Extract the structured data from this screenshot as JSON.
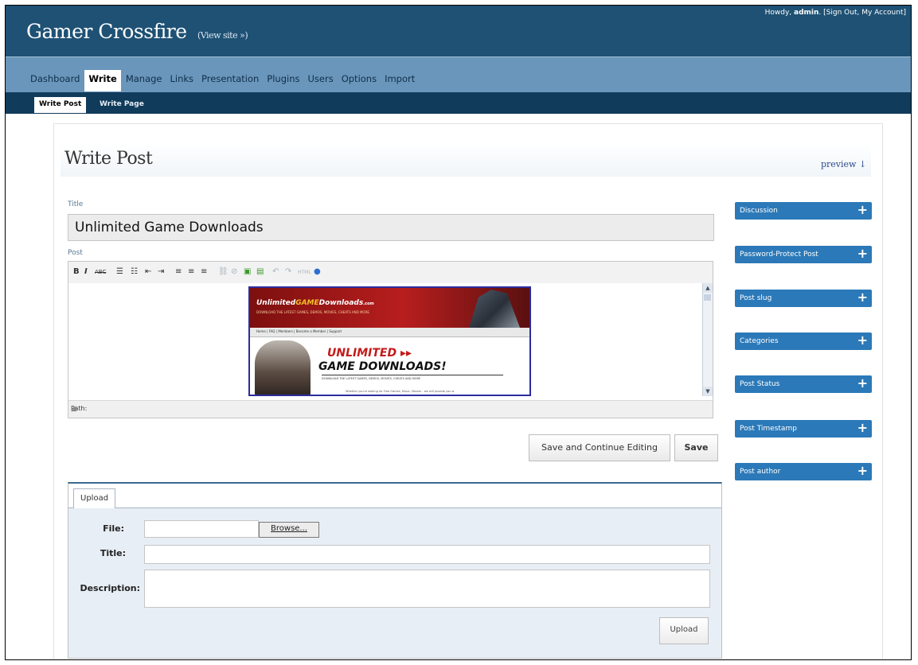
{
  "header": {
    "site_title": "Gamer Crossfire",
    "view_site": "(View site »)",
    "user_howdy": "Howdy,",
    "user_name": "admin",
    "user_links": "[Sign Out, My Account]"
  },
  "nav": {
    "tabs": [
      "Dashboard",
      "Write",
      "Manage",
      "Links",
      "Presentation",
      "Plugins",
      "Users",
      "Options",
      "Import"
    ],
    "active": "Write",
    "subtabs": [
      "Write Post",
      "Write Page"
    ]
  },
  "page": {
    "title": "Write Post",
    "preview": "preview ↓"
  },
  "form": {
    "title_label": "Title",
    "title_value": "Unlimited Game Downloads",
    "post_label": "Post",
    "path_label": "Path:"
  },
  "toolbar": {
    "bold": "B",
    "italic": "I",
    "strike": "ABC",
    "ul": "☰",
    "ol": "☷",
    "outdent": "⇤",
    "indent": "⇥",
    "align_left": "≡",
    "align_center": "≡",
    "align_right": "≡",
    "link": "⛓",
    "unlink": "⊘",
    "image": "▣",
    "more": "▤",
    "undo": "↶",
    "redo": "↷",
    "html": "HTML",
    "help": "●"
  },
  "embed": {
    "logo_prefix": "Unlimited",
    "logo_game": "GAME",
    "logo_suffix": "Downloads",
    "logo_tld": ".com",
    "tagline": "DOWNLOAD THE LATEST GAMES, DEMOS, MOVIES, CHEATS AND MORE",
    "menu": "Home  |  FAQ  |  Members  |  Become a Member  |  Support",
    "headline1": "UNLIMITED ▸▸",
    "headline2": "GAME DOWNLOADS!",
    "small1": "DOWNLOAD THE LATEST GAMES, DEMOS, MOVIES, CHEATS AND MORE",
    "small2": "Whether you're looking for Free Games, Music, Movies - we will provide you w"
  },
  "buttons": {
    "save_continue": "Save and Continue Editing",
    "save": "Save"
  },
  "upload": {
    "tab": "Upload",
    "file_label": "File:",
    "browse": "Browse...",
    "title_label": "Title:",
    "description_label": "Description:",
    "upload_button": "Upload"
  },
  "sidebar": {
    "boxes": [
      "Discussion",
      "Password-Protect Post",
      "Post slug",
      "Categories",
      "Post Status",
      "Post Timestamp",
      "Post author"
    ],
    "plus": "+"
  },
  "colors": {
    "header_bg": "#1e5174",
    "nav_bg": "#6a96bb",
    "subnav_bg": "#103b5a",
    "sidebar_box": "#2b79b8",
    "upload_bg": "#e8eef5"
  }
}
